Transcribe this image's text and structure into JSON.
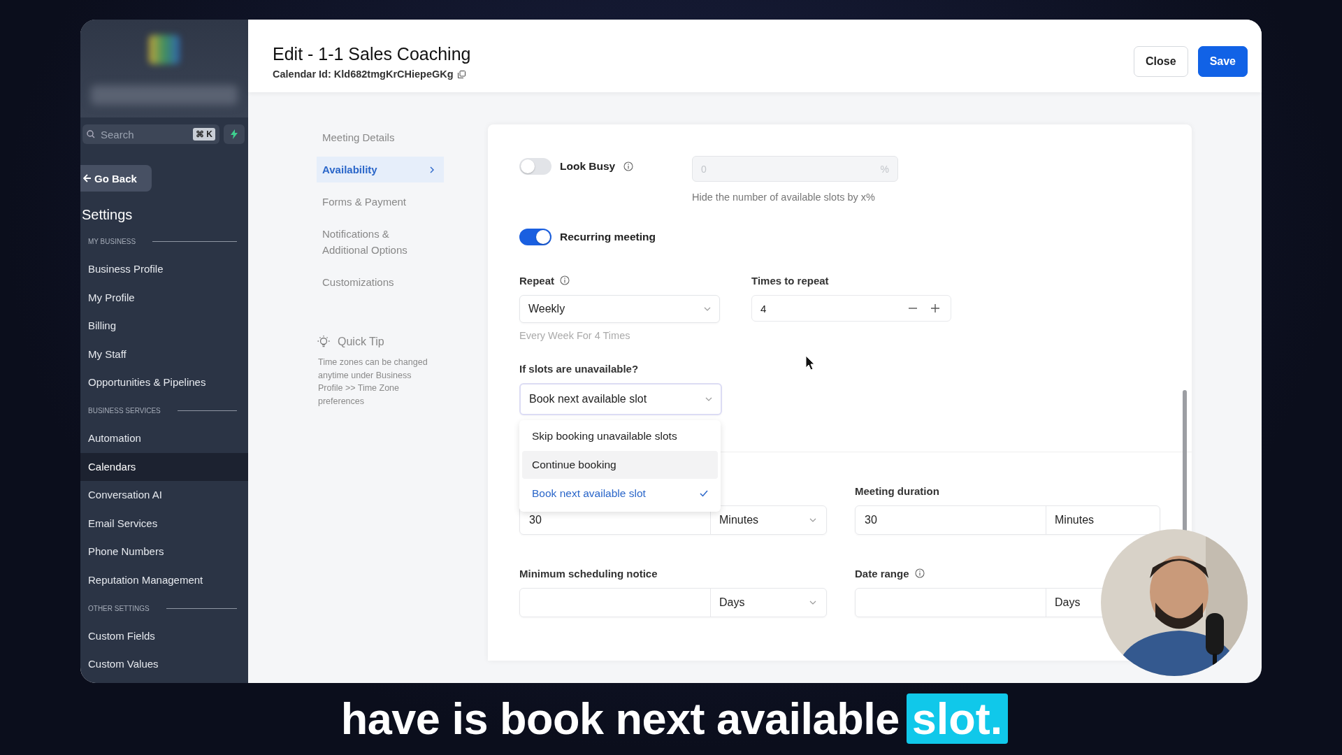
{
  "sidebar": {
    "search": {
      "placeholder": "Search",
      "shortcut": "⌘ K"
    },
    "back_button": "Go Back",
    "title": "Settings",
    "sections": [
      {
        "heading": "MY BUSINESS",
        "items": [
          {
            "label": "Business Profile",
            "selected": false
          },
          {
            "label": "My Profile",
            "selected": false
          },
          {
            "label": "Billing",
            "selected": false
          },
          {
            "label": "My Staff",
            "selected": false
          },
          {
            "label": "Opportunities & Pipelines",
            "selected": false
          }
        ]
      },
      {
        "heading": "BUSINESS SERVICES",
        "items": [
          {
            "label": "Automation",
            "selected": false
          },
          {
            "label": "Calendars",
            "selected": true
          },
          {
            "label": "Conversation AI",
            "selected": false
          },
          {
            "label": "Email Services",
            "selected": false
          },
          {
            "label": "Phone Numbers",
            "selected": false
          },
          {
            "label": "Reputation Management",
            "selected": false
          }
        ]
      },
      {
        "heading": "OTHER SETTINGS",
        "items": [
          {
            "label": "Custom Fields",
            "selected": false
          },
          {
            "label": "Custom Values",
            "selected": false
          }
        ]
      }
    ]
  },
  "header": {
    "title": "Edit - 1-1 Sales Coaching",
    "calendar_id": "Calendar Id: Kld682tmgKrCHiepeGKg",
    "buttons": [
      {
        "label": "Close",
        "kind": "secondary"
      },
      {
        "label": "Save",
        "kind": "primary"
      }
    ]
  },
  "nav": {
    "items": [
      {
        "label": "Meeting Details",
        "selected": false
      },
      {
        "label": "Availability",
        "selected": true
      },
      {
        "label": "Forms & Payment",
        "selected": false
      },
      {
        "label": "Notifications & Additional Options",
        "selected": false
      },
      {
        "label": "Customizations",
        "selected": false
      }
    ],
    "quick_tip": {
      "title": "Quick Tip",
      "text": "Time zones can be changed anytime under Business Profile >> Time Zone preferences"
    }
  },
  "form": {
    "look_busy": {
      "label": "Look Busy",
      "on": false,
      "value": "0",
      "unit": "%",
      "help": "Hide the number of available slots by x%"
    },
    "recurring": {
      "label": "Recurring meeting",
      "on": true
    },
    "repeat": {
      "label": "Repeat",
      "value": "Weekly",
      "help": "Every Week For 4 Times"
    },
    "times_to_repeat": {
      "label": "Times to repeat",
      "value": "4"
    },
    "slots_unavailable": {
      "label": "If slots are unavailable?",
      "value": "Book next available slot",
      "expanded": true,
      "options": [
        {
          "label": "Skip booking unavailable slots",
          "selected": false,
          "hovered": false
        },
        {
          "label": "Continue booking",
          "selected": false,
          "hovered": true
        },
        {
          "label": "Book next available slot",
          "selected": true,
          "hovered": false
        }
      ]
    },
    "field_rows": [
      [
        {
          "value": "30",
          "unit": "Minutes"
        },
        {
          "label": "Meeting duration",
          "value": "30",
          "unit": "Minutes",
          "info": false
        }
      ],
      [
        {
          "label": "Minimum scheduling notice",
          "unit": "Days",
          "info": false
        },
        {
          "label": "Date range",
          "unit": "Days",
          "info": true
        }
      ]
    ]
  },
  "subtitle": {
    "text": "have is book next available",
    "highlight": "slot."
  }
}
